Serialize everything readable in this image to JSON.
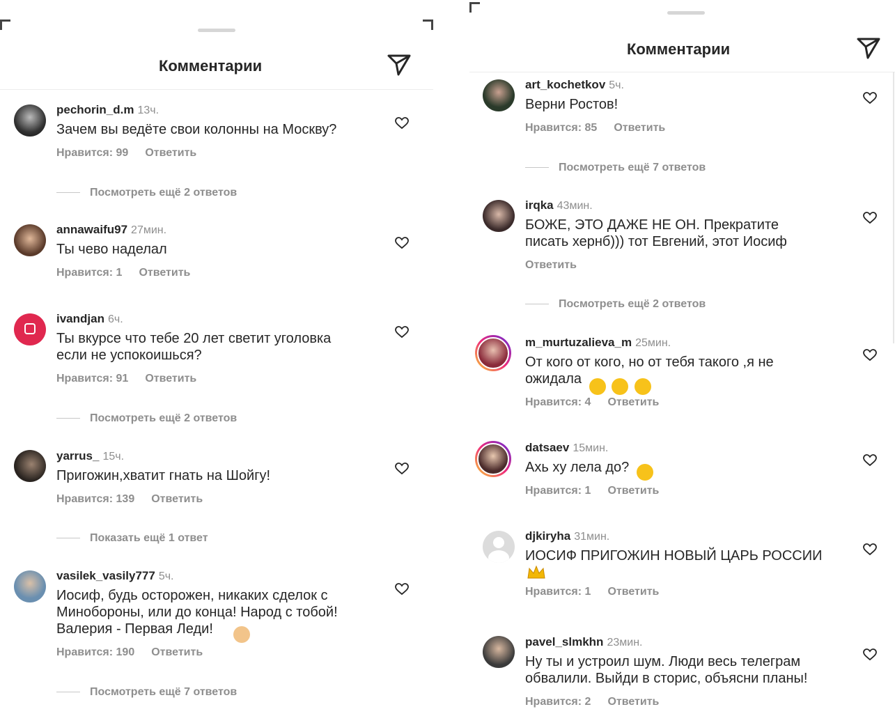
{
  "left": {
    "title": "Комментарии",
    "comments": [
      {
        "user": "pechorin_d.m",
        "time": "13ч.",
        "text": "Зачем вы ведёте свои колонны на Москву?",
        "likes": "Нравится: 99",
        "reply": "Ответить",
        "more": "Посмотреть ещё 2 ответов"
      },
      {
        "user": "annawaifu97",
        "time": "27мин.",
        "text": "Ты чево наделал",
        "likes": "Нравится: 1",
        "reply": "Ответить",
        "more": ""
      },
      {
        "user": "ivandjan",
        "time": "6ч.",
        "text": "Ты вкурсе что тебе 20 лет светит уголовка\nесли не успокоишься?",
        "likes": "Нравится: 91",
        "reply": "Ответить",
        "more": "Посмотреть ещё 2 ответов"
      },
      {
        "user": "yarrus_",
        "time": "15ч.",
        "text": "Пригожин,хватит гнать на Шойгу!",
        "likes": "Нравится: 139",
        "reply": "Ответить",
        "more": "Показать ещё 1 ответ"
      },
      {
        "user": "vasilek_vasily777",
        "time": "5ч.",
        "text": "Иосиф, будь осторожен, никаких сделок с\nМинобороны, или до конца! Народ с тобой!\nВалерия - Первая Леди!",
        "likes": "Нравится: 190",
        "reply": "Ответить",
        "more": "Посмотреть ещё 7 ответов"
      }
    ]
  },
  "right": {
    "title": "Комментарии",
    "comments": [
      {
        "user": "art_kochetkov",
        "time": "5ч.",
        "text": "Верни Ростов!",
        "likes": "Нравится: 85",
        "reply": "Ответить",
        "more": "Посмотреть ещё 7 ответов"
      },
      {
        "user": "irqka",
        "time": "43мин.",
        "text": "БОЖЕ, ЭТО ДАЖЕ НЕ ОН. Прекратите\nписать хернб))) тот Евгений, этот Иосиф",
        "likes": "",
        "reply": "Ответить",
        "more": "Посмотреть ещё 2 ответов"
      },
      {
        "user": "m_murtuzalieva_m",
        "time": "25мин.",
        "text": "От кого от кого, но от тебя такого ,я не\nожидала",
        "likes": "Нравится: 4",
        "reply": "Ответить",
        "more": ""
      },
      {
        "user": "datsaev",
        "time": "15мин.",
        "text": "Ахь ху лела до?",
        "likes": "Нравится: 1",
        "reply": "Ответить",
        "more": ""
      },
      {
        "user": "djkiryha",
        "time": "31мин.",
        "text": "ИОСИФ ПРИГОЖИН НОВЫЙ ЦАРЬ РОССИИ",
        "likes": "Нравится: 1",
        "reply": "Ответить",
        "more": ""
      },
      {
        "user": "pavel_slmkhn",
        "time": "23мин.",
        "text": "Ну ты и устроил шум. Люди весь телеграм\nобвалили. Выйди в сторис, объясни планы!",
        "likes": "Нравится: 2",
        "reply": "Ответить",
        "more": ""
      }
    ]
  },
  "icons": {
    "send": "send-icon",
    "like": "heart-icon"
  }
}
